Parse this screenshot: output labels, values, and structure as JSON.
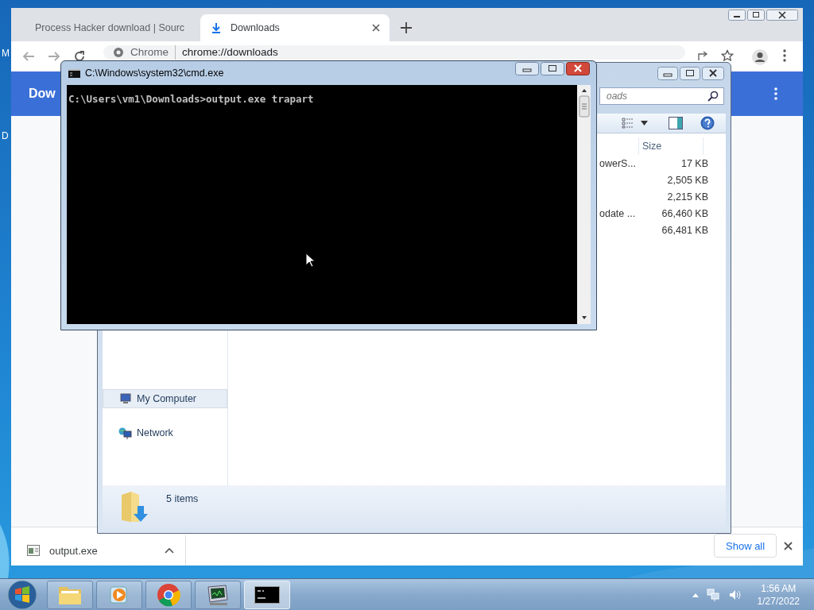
{
  "desktop": {
    "icon_labels": [
      "M",
      "D"
    ]
  },
  "browser": {
    "tabs": [
      {
        "title": "Process Hacker download | Sourc",
        "selected": false
      },
      {
        "title": "Downloads",
        "selected": true
      }
    ],
    "omnibox": {
      "site_label": "Chrome",
      "url": "chrome://downloads"
    },
    "page_header": {
      "title": "Dow"
    },
    "download_shelf": {
      "items": [
        {
          "file": "output.exe"
        }
      ],
      "show_all": "Show all"
    }
  },
  "explorer": {
    "search": {
      "placeholder": "oads"
    },
    "columns": [
      "Size"
    ],
    "rows": [
      {
        "name": "owerS...",
        "size": "17 KB"
      },
      {
        "size": "2,505 KB"
      },
      {
        "size": "2,215 KB"
      },
      {
        "name": "odate ...",
        "size": "66,460 KB"
      },
      {
        "size": "66,481 KB"
      }
    ],
    "nav_items": [
      {
        "label": "My Computer",
        "kind": "computer",
        "selected": true
      },
      {
        "label": "Network",
        "kind": "network",
        "selected": false
      }
    ],
    "status": "5 items"
  },
  "console": {
    "title": "C:\\Windows\\system32\\cmd.exe",
    "lines": [
      "C:\\Users\\vm1\\Downloads>output.exe trapart"
    ]
  },
  "taskbar": {
    "buttons": [
      {
        "kind": "folder",
        "selected": false
      },
      {
        "kind": "media",
        "selected": false
      },
      {
        "kind": "browser",
        "selected": false
      },
      {
        "kind": "monitor",
        "selected": false
      },
      {
        "kind": "console",
        "selected": true
      }
    ],
    "clock": {
      "time": "1:56 AM",
      "date": "1/27/2022"
    }
  }
}
